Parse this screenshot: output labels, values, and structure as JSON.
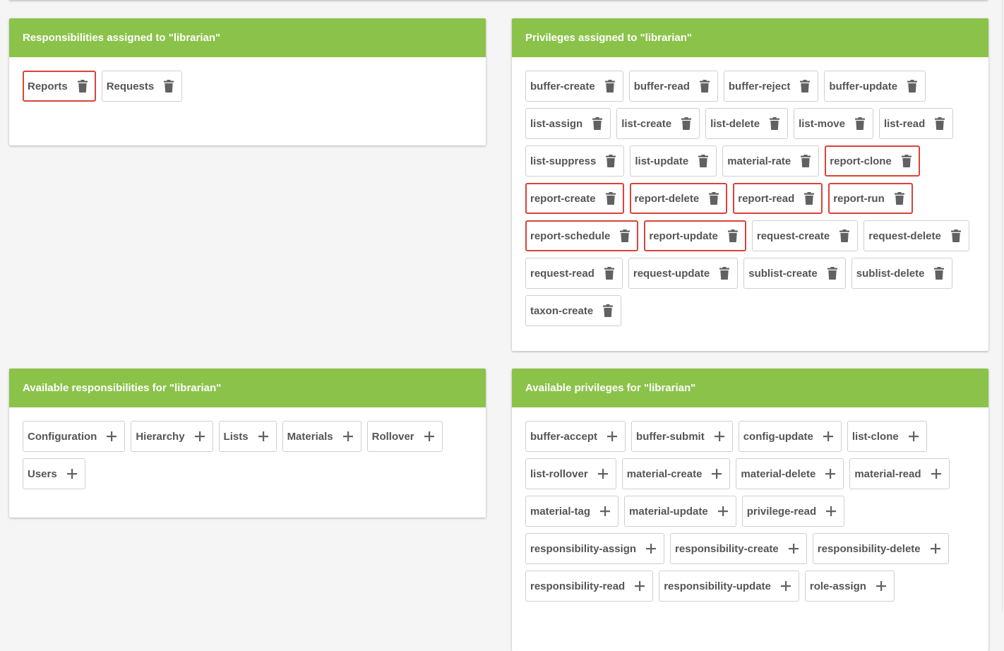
{
  "colors": {
    "header_bg": "#8bc34a",
    "highlight_border": "#d9433b",
    "icon": "#616161"
  },
  "assigned_responsibilities": {
    "title": "Responsibilities assigned to \"librarian\"",
    "chips": [
      {
        "label": "Reports",
        "highlighted": true
      },
      {
        "label": "Requests",
        "highlighted": false
      }
    ],
    "action_icon": "trash-icon"
  },
  "assigned_privileges": {
    "title": "Privileges assigned to \"librarian\"",
    "chips": [
      {
        "label": "buffer-create",
        "highlighted": false
      },
      {
        "label": "buffer-read",
        "highlighted": false
      },
      {
        "label": "buffer-reject",
        "highlighted": false
      },
      {
        "label": "buffer-update",
        "highlighted": false
      },
      {
        "label": "list-assign",
        "highlighted": false
      },
      {
        "label": "list-create",
        "highlighted": false
      },
      {
        "label": "list-delete",
        "highlighted": false
      },
      {
        "label": "list-move",
        "highlighted": false
      },
      {
        "label": "list-read",
        "highlighted": false
      },
      {
        "label": "list-suppress",
        "highlighted": false
      },
      {
        "label": "list-update",
        "highlighted": false
      },
      {
        "label": "material-rate",
        "highlighted": false
      },
      {
        "label": "report-clone",
        "highlighted": true
      },
      {
        "label": "report-create",
        "highlighted": true
      },
      {
        "label": "report-delete",
        "highlighted": true
      },
      {
        "label": "report-read",
        "highlighted": true
      },
      {
        "label": "report-run",
        "highlighted": true
      },
      {
        "label": "report-schedule",
        "highlighted": true
      },
      {
        "label": "report-update",
        "highlighted": true
      },
      {
        "label": "request-create",
        "highlighted": false
      },
      {
        "label": "request-delete",
        "highlighted": false
      },
      {
        "label": "request-read",
        "highlighted": false
      },
      {
        "label": "request-update",
        "highlighted": false
      },
      {
        "label": "sublist-create",
        "highlighted": false
      },
      {
        "label": "sublist-delete",
        "highlighted": false
      },
      {
        "label": "taxon-create",
        "highlighted": false
      }
    ],
    "action_icon": "trash-icon"
  },
  "available_responsibilities": {
    "title": "Available responsibilities for \"librarian\"",
    "chips": [
      {
        "label": "Configuration",
        "highlighted": false
      },
      {
        "label": "Hierarchy",
        "highlighted": false
      },
      {
        "label": "Lists",
        "highlighted": false
      },
      {
        "label": "Materials",
        "highlighted": false
      },
      {
        "label": "Rollover",
        "highlighted": false
      },
      {
        "label": "Users",
        "highlighted": false
      }
    ],
    "action_icon": "plus-icon"
  },
  "available_privileges": {
    "title": "Available privileges for \"librarian\"",
    "chips": [
      {
        "label": "buffer-accept",
        "highlighted": false
      },
      {
        "label": "buffer-submit",
        "highlighted": false
      },
      {
        "label": "config-update",
        "highlighted": false
      },
      {
        "label": "list-clone",
        "highlighted": false
      },
      {
        "label": "list-rollover",
        "highlighted": false
      },
      {
        "label": "material-create",
        "highlighted": false
      },
      {
        "label": "material-delete",
        "highlighted": false
      },
      {
        "label": "material-read",
        "highlighted": false
      },
      {
        "label": "material-tag",
        "highlighted": false
      },
      {
        "label": "material-update",
        "highlighted": false
      },
      {
        "label": "privilege-read",
        "highlighted": false
      },
      {
        "label": "responsibility-assign",
        "highlighted": false
      },
      {
        "label": "responsibility-create",
        "highlighted": false
      },
      {
        "label": "responsibility-delete",
        "highlighted": false
      },
      {
        "label": "responsibility-read",
        "highlighted": false
      },
      {
        "label": "responsibility-update",
        "highlighted": false
      },
      {
        "label": "role-assign",
        "highlighted": false
      }
    ],
    "action_icon": "plus-icon"
  }
}
